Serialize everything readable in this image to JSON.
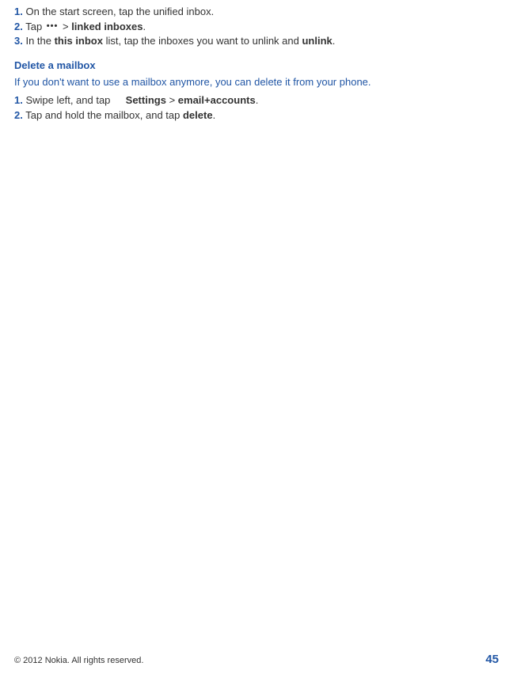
{
  "section1": {
    "step1": {
      "num": "1.",
      "text": " On the start screen, tap the unified inbox."
    },
    "step2": {
      "num": "2.",
      "text_before": " Tap ",
      "text_gt": " > ",
      "linked": "linked inboxes",
      "period": "."
    },
    "step3": {
      "num": "3.",
      "text_before": " In the ",
      "bold1": "this inbox",
      "text_mid": " list, tap the inboxes you want to unlink and ",
      "bold2": "unlink",
      "period": "."
    }
  },
  "section2": {
    "heading": "Delete a mailbox",
    "intro": "If you don't want to use a mailbox anymore, you can delete it from your phone.",
    "step1": {
      "num": "1.",
      "text_before": " Swipe left, and tap ",
      "settings": "Settings",
      "gt": " > ",
      "accounts": "email+accounts",
      "period": "."
    },
    "step2": {
      "num": "2.",
      "text_before": " Tap and hold the mailbox, and tap ",
      "bold": "delete",
      "period": "."
    }
  },
  "footer": {
    "copyright": "© 2012 Nokia. All rights reserved.",
    "page": "45"
  },
  "icons": {
    "dots": "•••"
  }
}
